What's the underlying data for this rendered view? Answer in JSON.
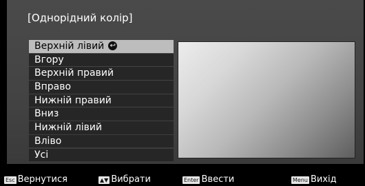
{
  "dialog": {
    "title": "[Однорідний колір]"
  },
  "menu": {
    "items": [
      {
        "label": "Верхній лівий",
        "selected": true
      },
      {
        "label": "Вгору"
      },
      {
        "label": "Верхній правий"
      },
      {
        "label": "Вправо"
      },
      {
        "label": "Нижній правий"
      },
      {
        "label": "Вниз"
      },
      {
        "label": "Нижній лівий"
      },
      {
        "label": "Вліво"
      },
      {
        "label": "Усі"
      }
    ]
  },
  "icons": {
    "selected_marker": "enter-arrow-icon",
    "selected_marker_glyph": "↩"
  },
  "footer": {
    "hints": [
      {
        "key": "Esc",
        "label": "Вернутися"
      },
      {
        "key": "▲▼",
        "label": "Вибрати"
      },
      {
        "key": "Enter",
        "label": "Ввести"
      },
      {
        "key": "Menu",
        "label": "Вихід"
      }
    ]
  },
  "colors": {
    "background": "#000000",
    "dialog_bg": "#474747",
    "menu_item_bg": "#262626",
    "menu_selected_bg": "#bdbdbd",
    "text": "#ffffff"
  }
}
